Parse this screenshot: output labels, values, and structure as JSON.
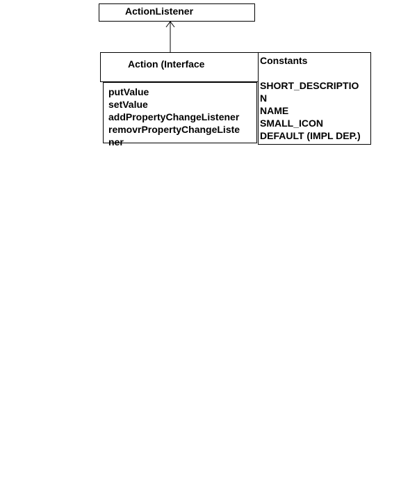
{
  "action_listener": {
    "label": "ActionListener"
  },
  "action_interface": {
    "label": "Action  (Interface"
  },
  "methods": {
    "lines": [
      "putValue",
      "setValue",
      "addPropertyChangeListener",
      "removrPropertyChangeListe",
      "ner"
    ]
  },
  "constants": {
    "title": "Constants",
    "lines": [
      "SHORT_DESCRIPTIO",
      "N",
      "NAME",
      "SMALL_ICON",
      "DEFAULT (IMPL DEP.)"
    ]
  },
  "colors": {
    "stroke": "#000000",
    "background": "#ffffff"
  }
}
